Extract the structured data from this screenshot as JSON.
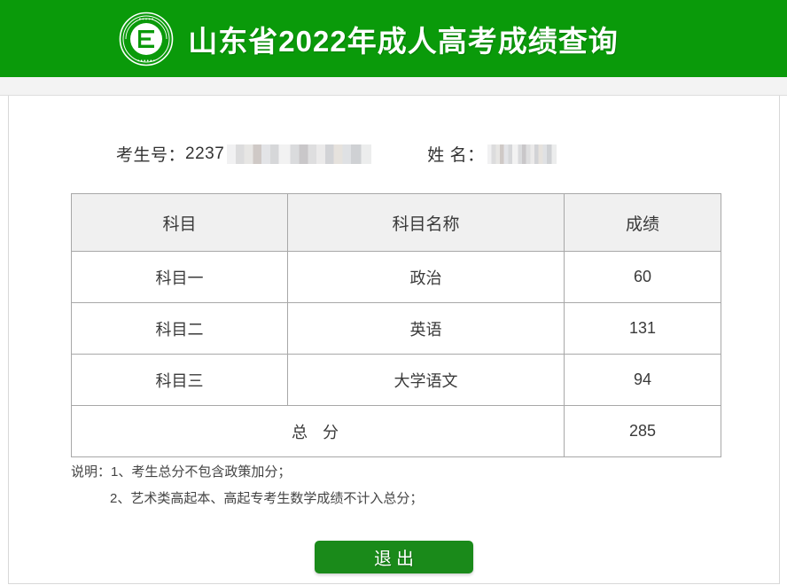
{
  "header": {
    "title": "山东省2022年成人高考成绩查询",
    "logo_icon": "circular-emblem-icon",
    "background_color": "#0a9a0a",
    "title_color": "#ffffff"
  },
  "candidate": {
    "id_label": "考生号：",
    "id_value_visible": "2237",
    "id_redacted": true,
    "name_label": "姓 名：",
    "name_value_visible": "",
    "name_redacted": true
  },
  "score_table": {
    "columns": [
      "科目",
      "科目名称",
      "成绩"
    ],
    "rows": [
      {
        "subject": "科目一",
        "name": "政治",
        "score": "60"
      },
      {
        "subject": "科目二",
        "name": "英语",
        "score": "131"
      },
      {
        "subject": "科目三",
        "name": "大学语文",
        "score": "94"
      }
    ],
    "total_label": "总 分",
    "total_score": "285",
    "header_background": "#f0f0f0",
    "border_color": "#a8a8a8"
  },
  "notes": {
    "line1": "说明：1、考生总分不包含政策加分；",
    "line2": "2、艺术类高起本、高起专考生数学成绩不计入总分；"
  },
  "actions": {
    "exit_label": "退出",
    "exit_color": "#1a8a1a"
  }
}
